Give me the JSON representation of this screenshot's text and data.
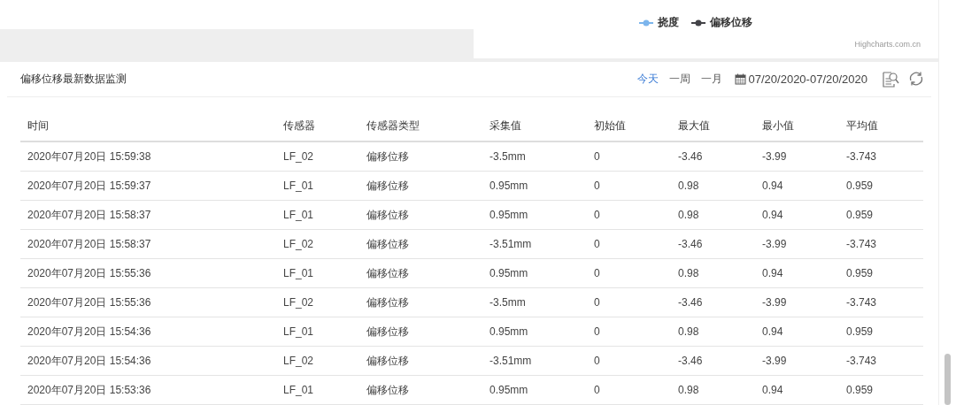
{
  "chart_legend": [
    {
      "label": "挠度",
      "color": "#7cb5ec"
    },
    {
      "label": "偏移位移",
      "color": "#434348"
    }
  ],
  "chart_credit": "Highcharts.com.cn",
  "panel": {
    "title": "偏移位移最新数据监测",
    "ranges": [
      {
        "label": "今天",
        "selected": true
      },
      {
        "label": "一周",
        "selected": false
      },
      {
        "label": "一月",
        "selected": false
      }
    ],
    "date_range": "07/20/2020-07/20/2020"
  },
  "table": {
    "columns": [
      "时间",
      "传感器",
      "传感器类型",
      "采集值",
      "初始值",
      "最大值",
      "最小值",
      "平均值"
    ],
    "rows": [
      [
        "2020年07月20日 15:59:38",
        "LF_02",
        "偏移位移",
        "-3.5mm",
        "0",
        "-3.46",
        "-3.99",
        "-3.743"
      ],
      [
        "2020年07月20日 15:59:37",
        "LF_01",
        "偏移位移",
        "0.95mm",
        "0",
        "0.98",
        "0.94",
        "0.959"
      ],
      [
        "2020年07月20日 15:58:37",
        "LF_01",
        "偏移位移",
        "0.95mm",
        "0",
        "0.98",
        "0.94",
        "0.959"
      ],
      [
        "2020年07月20日 15:58:37",
        "LF_02",
        "偏移位移",
        "-3.51mm",
        "0",
        "-3.46",
        "-3.99",
        "-3.743"
      ],
      [
        "2020年07月20日 15:55:36",
        "LF_01",
        "偏移位移",
        "0.95mm",
        "0",
        "0.98",
        "0.94",
        "0.959"
      ],
      [
        "2020年07月20日 15:55:36",
        "LF_02",
        "偏移位移",
        "-3.5mm",
        "0",
        "-3.46",
        "-3.99",
        "-3.743"
      ],
      [
        "2020年07月20日 15:54:36",
        "LF_01",
        "偏移位移",
        "0.95mm",
        "0",
        "0.98",
        "0.94",
        "0.959"
      ],
      [
        "2020年07月20日 15:54:36",
        "LF_02",
        "偏移位移",
        "-3.51mm",
        "0",
        "-3.46",
        "-3.99",
        "-3.743"
      ],
      [
        "2020年07月20日 15:53:36",
        "LF_01",
        "偏移位移",
        "0.95mm",
        "0",
        "0.98",
        "0.94",
        "0.959"
      ]
    ]
  }
}
